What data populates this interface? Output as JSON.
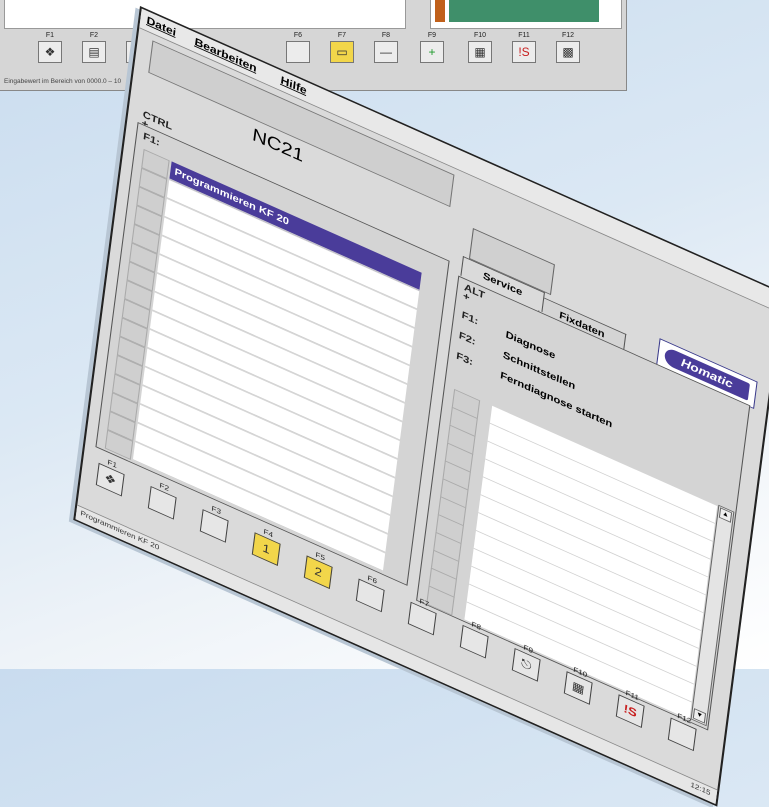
{
  "background_window": {
    "fkeys": [
      {
        "label": "F1",
        "icon": "book-icon"
      },
      {
        "label": "F2",
        "icon": "cabinet-icon"
      },
      {
        "label": "F3",
        "icon": "cabinet-icon"
      },
      {
        "label": "F6",
        "icon": "blank-icon"
      },
      {
        "label": "F7",
        "icon": "folder-icon"
      },
      {
        "label": "F8",
        "icon": "minus-icon"
      },
      {
        "label": "F9",
        "icon": "plus-icon"
      },
      {
        "label": "F10",
        "icon": "grid-icon"
      },
      {
        "label": "F11",
        "icon": "escape-icon"
      },
      {
        "label": "F12",
        "icon": "keyboard-icon"
      }
    ],
    "status_text": "Eingabewert im Bereich von 0000.0 – 10"
  },
  "menu": {
    "file": "Datei",
    "edit": "Bearbeiten",
    "help": "Hilfe"
  },
  "app_title": "NC21",
  "left_panel": {
    "modifier_label": "CTRL\n+",
    "f1_label": "F1:",
    "items": [
      "Programmieren KF 20",
      "",
      "",
      "",
      "",
      "",
      "",
      "",
      "",
      "",
      "",
      "",
      "",
      "",
      "",
      ""
    ]
  },
  "right_panel": {
    "tabs": [
      {
        "label": "Service"
      },
      {
        "label": "Fixdaten"
      }
    ],
    "modifier_label": "ALT\n+",
    "commands": [
      {
        "key": "F1:",
        "label": "Diagnose"
      },
      {
        "key": "F2:",
        "label": "Schnittstellen"
      },
      {
        "key": "F3:",
        "label": "Ferndiagnose starten"
      }
    ],
    "logo_text": "Homatic"
  },
  "fkeys": [
    {
      "label": "F1",
      "icon": "book-icon",
      "glyph": "❖"
    },
    {
      "label": "F2",
      "icon": "blank-icon",
      "glyph": ""
    },
    {
      "label": "F3",
      "icon": "blank-icon",
      "glyph": ""
    },
    {
      "label": "F4",
      "icon": "folder-1-icon",
      "glyph": "1"
    },
    {
      "label": "F5",
      "icon": "folder-2-icon",
      "glyph": "2"
    },
    {
      "label": "F6",
      "icon": "blank-icon",
      "glyph": ""
    },
    {
      "label": "F7",
      "icon": "blank-icon",
      "glyph": ""
    },
    {
      "label": "F8",
      "icon": "blank-icon",
      "glyph": ""
    },
    {
      "label": "F9",
      "icon": "esc-door-icon",
      "glyph": "⎋"
    },
    {
      "label": "F10",
      "icon": "grid-icon",
      "glyph": "▦"
    },
    {
      "label": "F11",
      "icon": "escape-icon",
      "glyph": "!S"
    },
    {
      "label": "F12",
      "icon": "blank-icon",
      "glyph": ""
    }
  ],
  "status": {
    "left": "Programmieren KF 20",
    "right": "12:15"
  }
}
